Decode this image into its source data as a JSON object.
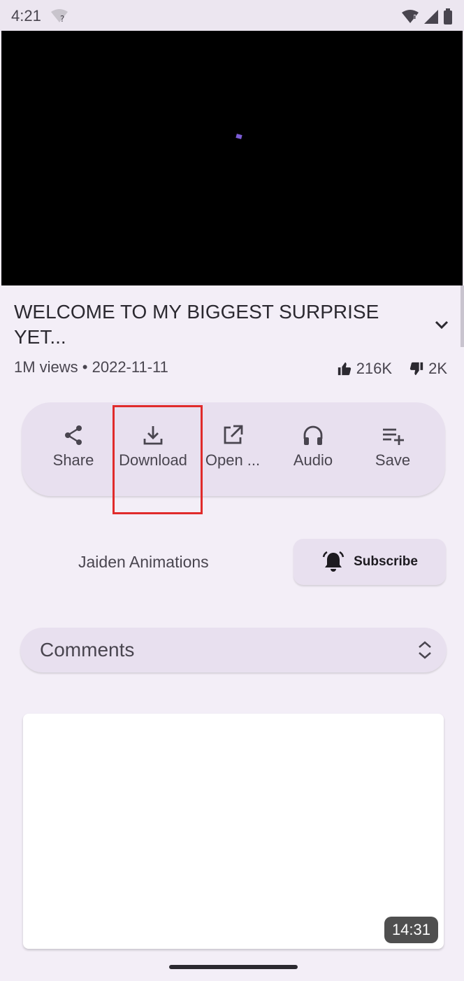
{
  "status_bar": {
    "time": "4:21"
  },
  "video": {
    "title": "WELCOME TO MY BIGGEST SURPRISE YET...",
    "meta": "1M views • 2022-11-11",
    "likes": "216K",
    "dislikes": "2K"
  },
  "actions": [
    {
      "label": "Share",
      "icon": "share-icon"
    },
    {
      "label": "Download",
      "icon": "download-icon"
    },
    {
      "label": "Open ...",
      "icon": "open-external-icon"
    },
    {
      "label": "Audio",
      "icon": "headphones-icon"
    },
    {
      "label": "Save",
      "icon": "playlist-add-icon"
    }
  ],
  "channel": {
    "name": "Jaiden Animations",
    "subscribe_label": "Subscribe"
  },
  "comments": {
    "label": "Comments"
  },
  "related": [
    {
      "duration": "14:31"
    }
  ],
  "colors": {
    "accent": "#e8e0ef",
    "highlight": "#e02b2b",
    "background": "#f3eef7"
  }
}
